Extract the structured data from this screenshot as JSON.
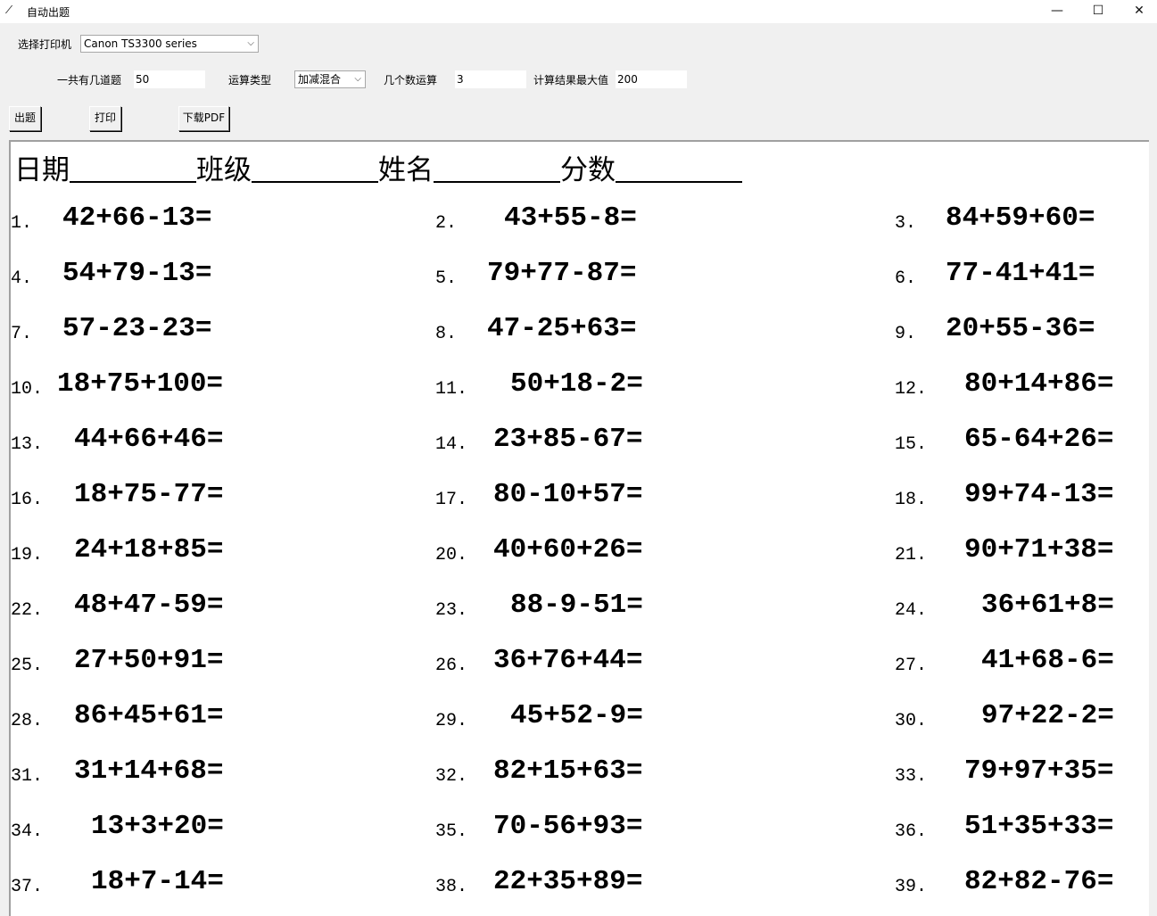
{
  "window": {
    "title": "自动出题",
    "icon": "feather-icon"
  },
  "printer": {
    "label": "选择打印机",
    "value": "Canon TS3300 series"
  },
  "settings": {
    "count_label": "一共有几道题",
    "count_value": "50",
    "type_label": "运算类型",
    "type_value": "加减混合",
    "operands_label": "几个数运算",
    "operands_value": "3",
    "max_label": "计算结果最大值",
    "max_value": "200"
  },
  "buttons": {
    "generate": "出题",
    "print": "打印",
    "pdf": "下载PDF"
  },
  "sheet": {
    "date": "日期",
    "class": "班级",
    "name": "姓名",
    "score": "分数"
  },
  "questions": [
    {
      "n": "1.",
      "e": "42+66-13="
    },
    {
      "n": "2.",
      "e": "43+55-8="
    },
    {
      "n": "3.",
      "e": "84+59+60="
    },
    {
      "n": "4.",
      "e": "54+79-13="
    },
    {
      "n": "5.",
      "e": "79+77-87="
    },
    {
      "n": "6.",
      "e": "77-41+41="
    },
    {
      "n": "7.",
      "e": "57-23-23="
    },
    {
      "n": "8.",
      "e": "47-25+63="
    },
    {
      "n": "9.",
      "e": "20+55-36="
    },
    {
      "n": "10.",
      "e": "18+75+100="
    },
    {
      "n": "11.",
      "e": "50+18-2="
    },
    {
      "n": "12.",
      "e": "80+14+86="
    },
    {
      "n": "13.",
      "e": "44+66+46="
    },
    {
      "n": "14.",
      "e": "23+85-67="
    },
    {
      "n": "15.",
      "e": "65-64+26="
    },
    {
      "n": "16.",
      "e": "18+75-77="
    },
    {
      "n": "17.",
      "e": "80-10+57="
    },
    {
      "n": "18.",
      "e": "99+74-13="
    },
    {
      "n": "19.",
      "e": "24+18+85="
    },
    {
      "n": "20.",
      "e": "40+60+26="
    },
    {
      "n": "21.",
      "e": "90+71+38="
    },
    {
      "n": "22.",
      "e": "48+47-59="
    },
    {
      "n": "23.",
      "e": "88-9-51="
    },
    {
      "n": "24.",
      "e": "36+61+8="
    },
    {
      "n": "25.",
      "e": "27+50+91="
    },
    {
      "n": "26.",
      "e": "36+76+44="
    },
    {
      "n": "27.",
      "e": "41+68-6="
    },
    {
      "n": "28.",
      "e": "86+45+61="
    },
    {
      "n": "29.",
      "e": "45+52-9="
    },
    {
      "n": "30.",
      "e": "97+22-2="
    },
    {
      "n": "31.",
      "e": "31+14+68="
    },
    {
      "n": "32.",
      "e": "82+15+63="
    },
    {
      "n": "33.",
      "e": "79+97+35="
    },
    {
      "n": "34.",
      "e": "13+3+20="
    },
    {
      "n": "35.",
      "e": "70-56+93="
    },
    {
      "n": "36.",
      "e": "51+35+33="
    },
    {
      "n": "37.",
      "e": "18+7-14="
    },
    {
      "n": "38.",
      "e": "22+35+89="
    },
    {
      "n": "39.",
      "e": "82+82-76="
    }
  ]
}
